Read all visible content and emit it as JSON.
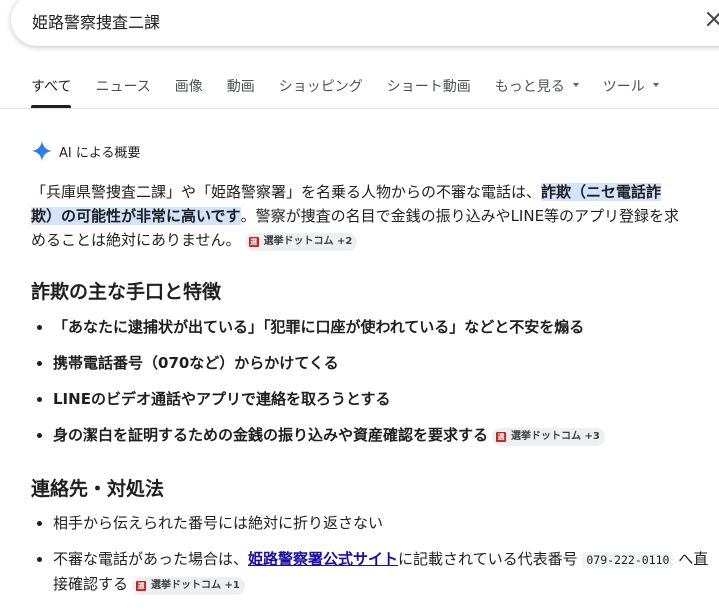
{
  "search": {
    "query": "姫路警察捜査二課",
    "clear_icon": "close-icon"
  },
  "tabs": [
    {
      "label": "すべて",
      "active": true
    },
    {
      "label": "ニュース"
    },
    {
      "label": "画像"
    },
    {
      "label": "動画"
    },
    {
      "label": "ショッピング"
    },
    {
      "label": "ショート動画"
    },
    {
      "label": "もっと見る",
      "dropdown": true
    },
    {
      "label": "ツール",
      "dropdown": true
    }
  ],
  "ai_overview": {
    "header": "AI による概要",
    "intro_part1": "「兵庫県警捜査二課」や「姫路警察署」を名乗る人物からの不審な電話は、",
    "intro_highlight": "詐欺（ニセ電話詐欺）の可能性が非常に高いです",
    "intro_part2": "。警察が捜査の名目で金銭の振り込みやLINE等のアプリ登録を求めることは絶対にありません。",
    "intro_chip": "選挙ドットコム +2"
  },
  "section1": {
    "title": "詐欺の主な手口と特徴",
    "items": [
      "「あなたに逮捕状が出ている」「犯罪に口座が使われている」などと不安を煽る",
      "携帯電話番号（070など）からかけてくる",
      "LINEのビデオ通話やアプリで連絡を取ろうとする",
      "身の潔白を証明するための金銭の振り込みや資産確認を要求する"
    ],
    "chip": "選挙ドットコム +3"
  },
  "section2": {
    "title": "連絡先・対処法",
    "item1": "相手から伝えられた番号には絶対に折り返さない",
    "item2_pre": "不審な電話があった場合は、",
    "item2_link": "姫路警察署公式サイト",
    "item2_mid": "に記載されている代表番号",
    "item2_phone": "079-222-0110",
    "item2_post": "へ直接確認する",
    "chip": "選挙ドットコム +1"
  },
  "colors": {
    "accent": "#1a73e8",
    "highlight": "#d3e3fd",
    "link": "#1a0dab"
  }
}
